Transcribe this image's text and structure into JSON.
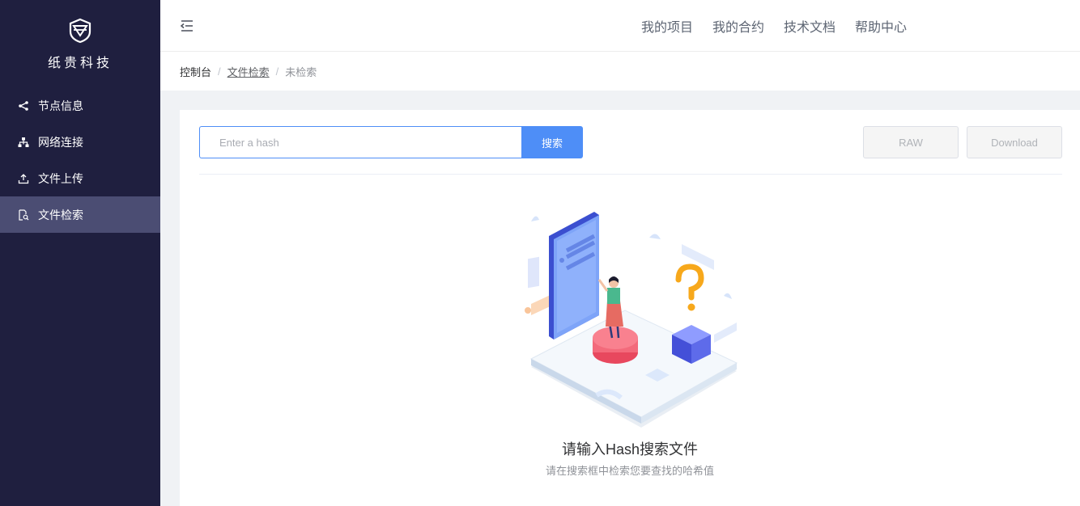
{
  "brand": {
    "name": "纸贵科技"
  },
  "sidebar": {
    "items": [
      {
        "label": "节点信息",
        "icon": "share-nodes-icon",
        "active": false
      },
      {
        "label": "网络连接",
        "icon": "network-icon",
        "active": false
      },
      {
        "label": "文件上传",
        "icon": "upload-icon",
        "active": false
      },
      {
        "label": "文件检索",
        "icon": "file-search-icon",
        "active": true
      }
    ]
  },
  "header": {
    "nav": [
      "我的项目",
      "我的合约",
      "技术文档",
      "帮助中心"
    ]
  },
  "breadcrumb": {
    "root": "控制台",
    "link": "文件检索",
    "current": "未检索",
    "separator": "/"
  },
  "search": {
    "placeholder": "Enter a hash",
    "value": "",
    "button_label": "搜索"
  },
  "actions": {
    "raw_label": "RAW",
    "download_label": "Download"
  },
  "empty_state": {
    "title": "请输入Hash搜索文件",
    "subtitle": "请在搜索框中检索您要查找的哈希值"
  },
  "colors": {
    "sidebar_bg": "#1f1f3f",
    "sidebar_active": "#4b4d73",
    "primary": "#4e8ef7"
  }
}
